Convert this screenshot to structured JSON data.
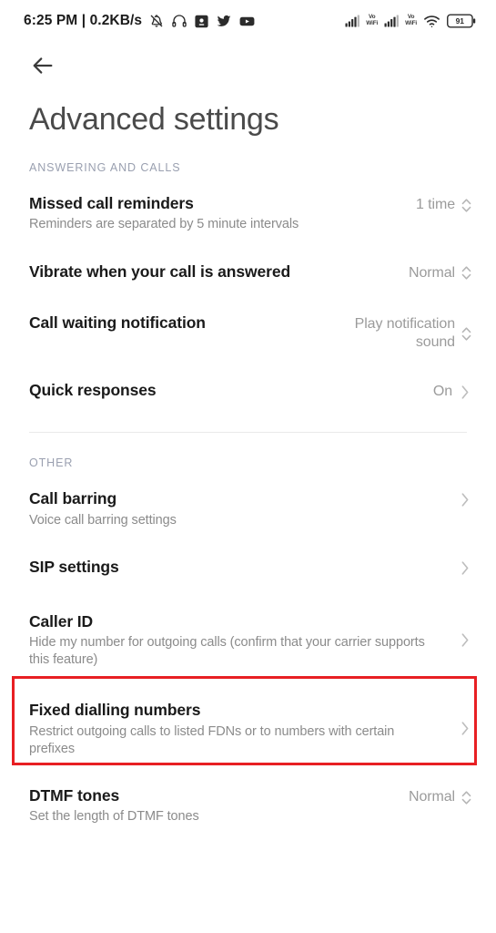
{
  "status_bar": {
    "clock": "6:25 PM",
    "separator": "|",
    "network_speed": "0.2KB/s",
    "left_icons": [
      "silent-bell-icon",
      "headphones-icon",
      "screenshot-icon",
      "twitter-icon",
      "youtube-icon"
    ],
    "right_icons": [
      "signal-bars-sim1-icon",
      "vowifi-sim1-label",
      "signal-bars-sim2-icon",
      "vowifi-sim2-label",
      "wifi-icon",
      "battery-icon"
    ],
    "vowifi_line1": "Vo",
    "vowifi_line2": "WiFi",
    "battery_level": "91"
  },
  "app_bar": {
    "back_icon": "arrow-left-icon",
    "title": "Advanced settings"
  },
  "sections": [
    {
      "header": "ANSWERING AND CALLS",
      "rows": [
        {
          "title": "Missed call reminders",
          "subtitle": "Reminders are separated by 5 minute intervals",
          "value": "1 time",
          "control": "stepper-icon"
        },
        {
          "title": "Vibrate when your call is answered",
          "subtitle": "",
          "value": "Normal",
          "control": "stepper-icon"
        },
        {
          "title": "Call waiting notification",
          "subtitle": "",
          "value": "Play notification sound",
          "control": "stepper-icon"
        },
        {
          "title": "Quick responses",
          "subtitle": "",
          "value": "On",
          "control": "chevron-right-icon"
        }
      ]
    },
    {
      "header": "OTHER",
      "rows": [
        {
          "title": "Call barring",
          "subtitle": "Voice call barring settings",
          "value": "",
          "control": "chevron-right-icon"
        },
        {
          "title": "SIP settings",
          "subtitle": "",
          "value": "",
          "control": "chevron-right-icon"
        },
        {
          "title": "Caller ID",
          "subtitle": "Hide my number for outgoing calls (confirm that your carrier supports this feature)",
          "value": "",
          "control": "chevron-right-icon",
          "highlighted": true
        },
        {
          "title": "Fixed dialling numbers",
          "subtitle": "Restrict outgoing calls to listed FDNs or to numbers with certain prefixes",
          "value": "",
          "control": "chevron-right-icon"
        },
        {
          "title": "DTMF tones",
          "subtitle": "Set the length of DTMF tones",
          "value": "Normal",
          "control": "stepper-icon"
        }
      ]
    }
  ],
  "highlight": {
    "color": "#e81f23",
    "target": "Caller ID"
  }
}
